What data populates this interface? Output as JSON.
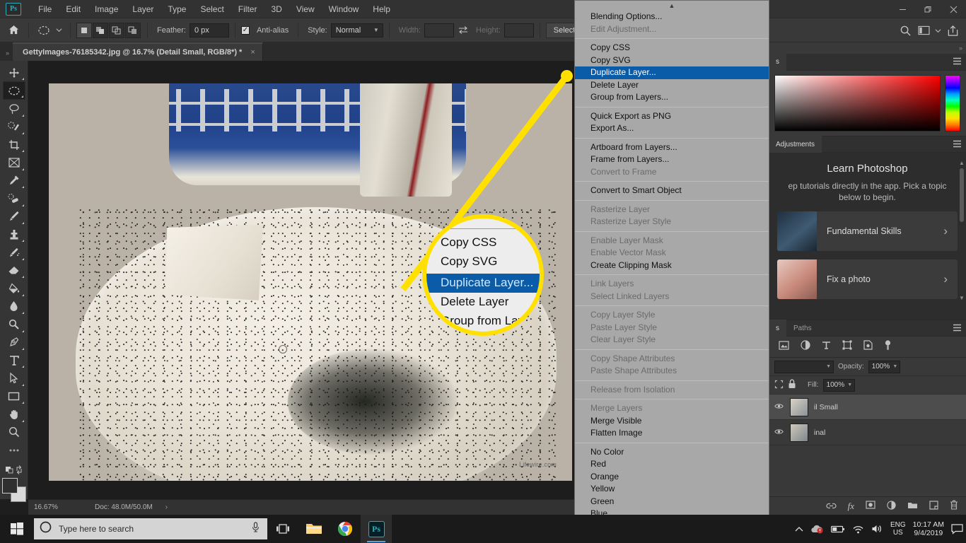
{
  "menubar": {
    "logo": "Ps",
    "items": [
      "File",
      "Edit",
      "Image",
      "Layer",
      "Type",
      "Select",
      "Filter",
      "3D",
      "View",
      "Window",
      "Help"
    ],
    "window_controls": {
      "minimize": "—",
      "restore": "❐",
      "close": "✕"
    }
  },
  "options_bar": {
    "home_icon": "home-icon",
    "tool_icon": "elliptical-marquee-icon",
    "feather_label": "Feather:",
    "feather_value": "0 px",
    "antialias_label": "Anti-alias",
    "antialias_checked": true,
    "style_label": "Style:",
    "style_value": "Normal",
    "width_label": "Width:",
    "width_value": "",
    "height_label": "Height:",
    "height_value": "",
    "select_and_mask": "Select and",
    "search_icon": "search-icon",
    "workspace_icon": "workspace-icon",
    "share_icon": "share-icon"
  },
  "tab_bar": {
    "collapse": "»",
    "document_title": "GettyImages-76185342.jpg @ 16.7% (Detail Small, RGB/8*) *",
    "close": "×"
  },
  "toolbar": {
    "tools": [
      {
        "name": "move-tool",
        "glyph": "move"
      },
      {
        "name": "elliptical-marquee-tool",
        "glyph": "ellipse",
        "active": true
      },
      {
        "name": "lasso-tool",
        "glyph": "lasso"
      },
      {
        "name": "quick-selection-tool",
        "glyph": "quickselect"
      },
      {
        "name": "crop-tool",
        "glyph": "crop"
      },
      {
        "name": "frame-tool",
        "glyph": "frame"
      },
      {
        "name": "eyedropper-tool",
        "glyph": "eyedropper"
      },
      {
        "name": "spot-healing-brush-tool",
        "glyph": "heal"
      },
      {
        "name": "brush-tool",
        "glyph": "brush"
      },
      {
        "name": "clone-stamp-tool",
        "glyph": "stamp"
      },
      {
        "name": "history-brush-tool",
        "glyph": "historybrush"
      },
      {
        "name": "eraser-tool",
        "glyph": "eraser"
      },
      {
        "name": "gradient-tool",
        "glyph": "paintbucket"
      },
      {
        "name": "blur-tool",
        "glyph": "blur"
      },
      {
        "name": "dodge-tool",
        "glyph": "dodge"
      },
      {
        "name": "pen-tool",
        "glyph": "pen"
      },
      {
        "name": "type-tool",
        "glyph": "type"
      },
      {
        "name": "path-selection-tool",
        "glyph": "arrow"
      },
      {
        "name": "rectangle-tool",
        "glyph": "rect"
      },
      {
        "name": "hand-tool",
        "glyph": "hand"
      },
      {
        "name": "zoom-tool",
        "glyph": "zoom"
      },
      {
        "name": "edit-toolbar-button",
        "glyph": "dots"
      }
    ],
    "quick_mask_icon": "quick-mask-icon",
    "swap_colors_icon": "swap-colors-icon",
    "foreground_color": "#2f2f2f",
    "background_color": "#d9d9d9"
  },
  "canvas": {
    "watermark": "Lifewire.com",
    "image_description": "photo of plate with ants and blue patterned bowl"
  },
  "status_bar": {
    "zoom": "16.67%",
    "doc_info": "Doc: 48.0M/50.0M",
    "expand_arrow": "›"
  },
  "context_menu": {
    "scroll_up": "▲",
    "scroll_down": "▼",
    "groups": [
      [
        {
          "label": "Blending Options...",
          "state": "normal"
        },
        {
          "label": "Edit Adjustment...",
          "state": "disabled"
        }
      ],
      [
        {
          "label": "Copy CSS",
          "state": "normal"
        },
        {
          "label": "Copy SVG",
          "state": "normal"
        },
        {
          "label": "Duplicate Layer...",
          "state": "highlighted"
        },
        {
          "label": "Delete Layer",
          "state": "normal"
        },
        {
          "label": "Group from Layers...",
          "state": "normal"
        }
      ],
      [
        {
          "label": "Quick Export as PNG",
          "state": "normal"
        },
        {
          "label": "Export As...",
          "state": "normal"
        }
      ],
      [
        {
          "label": "Artboard from Layers...",
          "state": "normal"
        },
        {
          "label": "Frame from Layers...",
          "state": "normal"
        },
        {
          "label": "Convert to Frame",
          "state": "disabled"
        }
      ],
      [
        {
          "label": "Convert to Smart Object",
          "state": "normal"
        }
      ],
      [
        {
          "label": "Rasterize Layer",
          "state": "disabled"
        },
        {
          "label": "Rasterize Layer Style",
          "state": "disabled"
        }
      ],
      [
        {
          "label": "Enable Layer Mask",
          "state": "disabled"
        },
        {
          "label": "Enable Vector Mask",
          "state": "disabled"
        },
        {
          "label": "Create Clipping Mask",
          "state": "normal"
        }
      ],
      [
        {
          "label": "Link Layers",
          "state": "disabled"
        },
        {
          "label": "Select Linked Layers",
          "state": "disabled"
        }
      ],
      [
        {
          "label": "Copy Layer Style",
          "state": "disabled"
        },
        {
          "label": "Paste Layer Style",
          "state": "disabled"
        },
        {
          "label": "Clear Layer Style",
          "state": "disabled"
        }
      ],
      [
        {
          "label": "Copy Shape Attributes",
          "state": "disabled"
        },
        {
          "label": "Paste Shape Attributes",
          "state": "disabled"
        }
      ],
      [
        {
          "label": "Release from Isolation",
          "state": "disabled"
        }
      ],
      [
        {
          "label": "Merge Layers",
          "state": "disabled"
        },
        {
          "label": "Merge Visible",
          "state": "normal"
        },
        {
          "label": "Flatten Image",
          "state": "normal"
        }
      ],
      [
        {
          "label": "No Color",
          "state": "normal"
        },
        {
          "label": "Red",
          "state": "normal"
        },
        {
          "label": "Orange",
          "state": "normal"
        },
        {
          "label": "Yellow",
          "state": "normal"
        },
        {
          "label": "Green",
          "state": "normal"
        },
        {
          "label": "Blue",
          "state": "normal"
        }
      ]
    ]
  },
  "callout": {
    "highlight_color": "#ffe000",
    "items": [
      {
        "label": "Copy CSS",
        "state": "normal"
      },
      {
        "label": "Copy SVG",
        "state": "normal"
      },
      {
        "label": "Duplicate Layer...",
        "state": "highlighted"
      },
      {
        "label": "Delete Layer",
        "state": "normal"
      },
      {
        "label": "Group from Layers",
        "state": "normal"
      }
    ]
  },
  "right_dock": {
    "collapse": "»",
    "color_panel": {
      "tab_label": "s",
      "menu_icon": "panel-menu-icon"
    },
    "adjustments": {
      "tab_label": "Adjustments",
      "menu_icon": "panel-menu-icon"
    },
    "learn": {
      "title": "Learn Photoshop",
      "description": "ep tutorials directly in the app. Pick a topic below to begin.",
      "cards": [
        {
          "label": "Fundamental Skills",
          "chevron": "›"
        },
        {
          "label": "Fix a photo",
          "chevron": "›"
        }
      ]
    },
    "layers_panel": {
      "tabs": [
        {
          "label": "s",
          "active": true
        },
        {
          "label": "Paths",
          "active": false
        }
      ],
      "menu_icon": "panel-menu-icon",
      "adjustment_icons": [
        "image-icon",
        "adjustment-icon",
        "text-icon",
        "transform-icon",
        "mask-icon",
        "eye-icon"
      ],
      "opacity_label": "Opacity:",
      "opacity_value": "100%",
      "fill_label": "Fill:",
      "fill_value": "100%",
      "lock_icons": [
        "lock-transparency-icon",
        "lock-all-icon"
      ],
      "layers": [
        {
          "name": "il Small",
          "selected": true
        },
        {
          "name": "inal",
          "selected": false
        }
      ],
      "footer_icons": [
        "link-layers-icon",
        "fx-icon",
        "add-mask-icon",
        "adjustment-layer-icon",
        "new-group-icon",
        "new-layer-icon",
        "delete-layer-icon"
      ]
    }
  },
  "taskbar": {
    "start_icon": "windows-start-icon",
    "search_placeholder": "Type here to search",
    "cortana_icon": "cortana-circle-icon",
    "mic_icon": "microphone-icon",
    "task_view_icon": "task-view-icon",
    "file_explorer_icon": "file-explorer-icon",
    "chrome_icon": "chrome-icon",
    "photoshop_icon": "Ps",
    "tray": {
      "chevron": "∧",
      "onedrive_icon": "onedrive-error-icon",
      "battery_icon": "battery-icon",
      "wifi_icon": "wifi-icon",
      "volume_icon": "volume-icon",
      "language_line1": "ENG",
      "language_line2": "US",
      "time": "10:17 AM",
      "date": "9/4/2019",
      "action_center_icon": "action-center-icon"
    }
  }
}
